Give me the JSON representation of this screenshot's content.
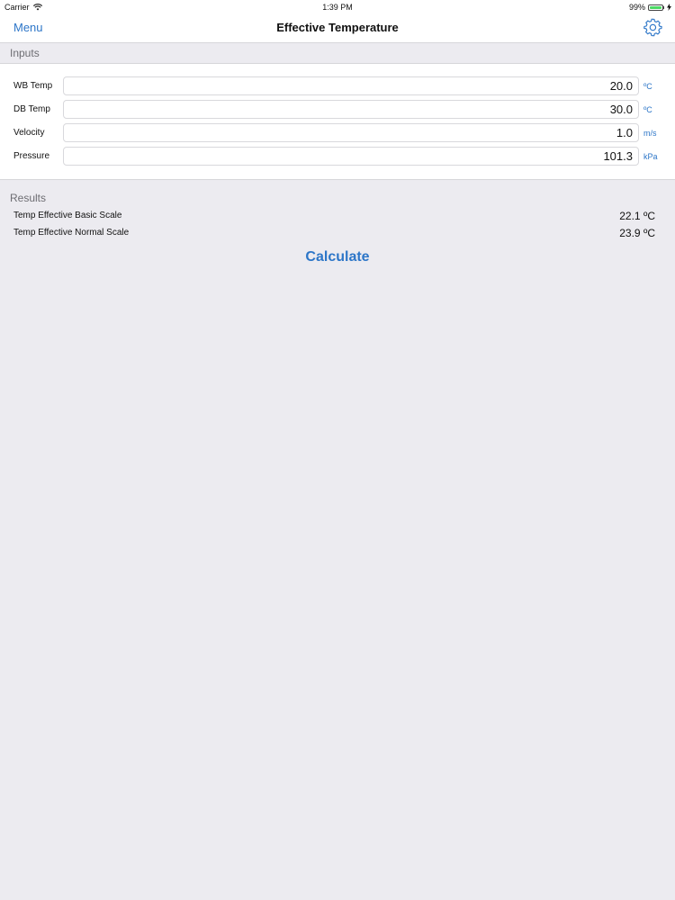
{
  "status_bar": {
    "carrier": "Carrier",
    "time": "1:39 PM",
    "battery": "99%",
    "battery_level": 0.99
  },
  "nav": {
    "menu_label": "Menu",
    "title": "Effective Temperature",
    "settings_icon": "gear-icon"
  },
  "inputs": {
    "header": "Inputs",
    "rows": [
      {
        "label": "WB Temp",
        "value": "20.0",
        "unit": "ºC"
      },
      {
        "label": "DB Temp",
        "value": "30.0",
        "unit": "ºC"
      },
      {
        "label": "Velocity",
        "value": "1.0",
        "unit": "m/s"
      },
      {
        "label": "Pressure",
        "value": "101.3",
        "unit": "kPa"
      }
    ]
  },
  "results": {
    "header": "Results",
    "rows": [
      {
        "label": "Temp Effective Basic Scale",
        "value": "22.1 ºC"
      },
      {
        "label": "Temp Effective Normal Scale",
        "value": "23.9 ºC"
      }
    ]
  },
  "calculate_label": "Calculate",
  "colors": {
    "accent": "#2d76c8",
    "background": "#ecebf0",
    "battery": "#4cd964"
  }
}
